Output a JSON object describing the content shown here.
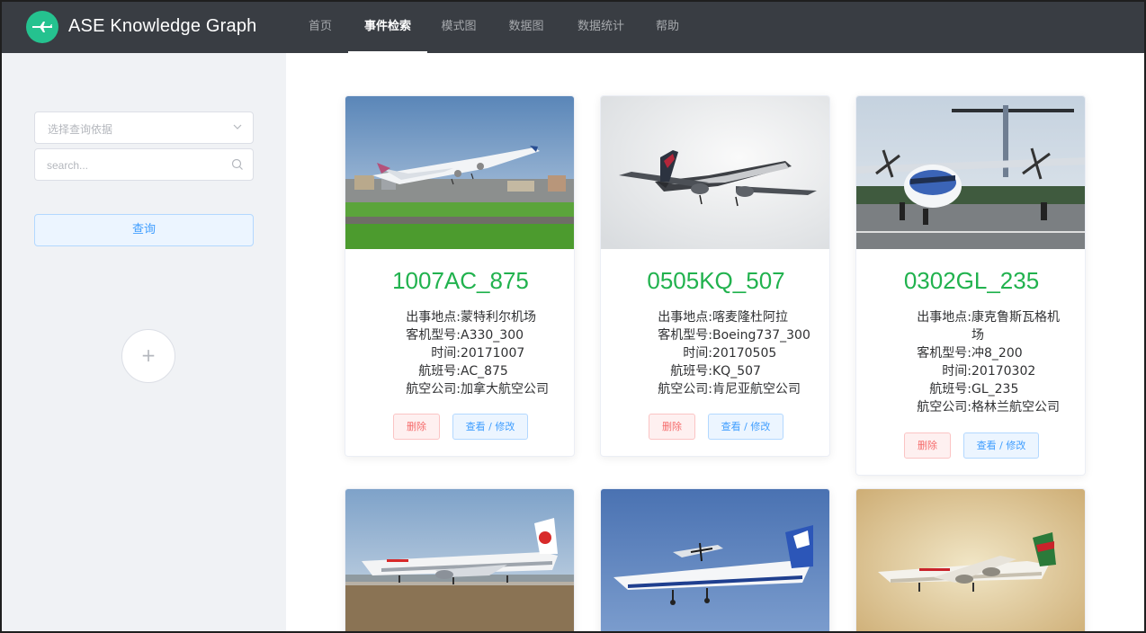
{
  "header": {
    "app_title": "ASE Knowledge Graph",
    "logo_icon": "airplane-icon",
    "nav": [
      {
        "label": "首页",
        "active": false
      },
      {
        "label": "事件检索",
        "active": true
      },
      {
        "label": "模式图",
        "active": false
      },
      {
        "label": "数据图",
        "active": false
      },
      {
        "label": "数据统计",
        "active": false
      },
      {
        "label": "帮助",
        "active": false
      }
    ]
  },
  "sidebar": {
    "select_placeholder": "选择查询依据",
    "search_placeholder": "search...",
    "query_button": "查询",
    "add_button": "+"
  },
  "labels": {
    "location": "出事地点:",
    "model": "客机型号:",
    "time": "时间:",
    "flight": "航班号:",
    "airline": "航空公司:",
    "delete": "删除",
    "view_edit": "查看 / 修改"
  },
  "cards": [
    {
      "id": "1007AC_875",
      "location": "蒙特利尔机场",
      "model": "A330_300",
      "time": "20171007",
      "flight": "AC_875",
      "airline": "加拿大航空公司"
    },
    {
      "id": "0505KQ_507",
      "location": "喀麦隆杜阿拉",
      "model": "Boeing737_300",
      "time": "20170505",
      "flight": "KQ_507",
      "airline": "肯尼亚航空公司"
    },
    {
      "id": "0302GL_235",
      "location": "康克鲁斯瓦格机场",
      "model": "冲8_200",
      "time": "20170302",
      "flight": "GL_235",
      "airline": "格林兰航空公司"
    }
  ],
  "colors": {
    "header_bg": "#393d43",
    "accent_green": "#21b24e",
    "primary_blue": "#409eff",
    "danger_red": "#f56c6c"
  }
}
